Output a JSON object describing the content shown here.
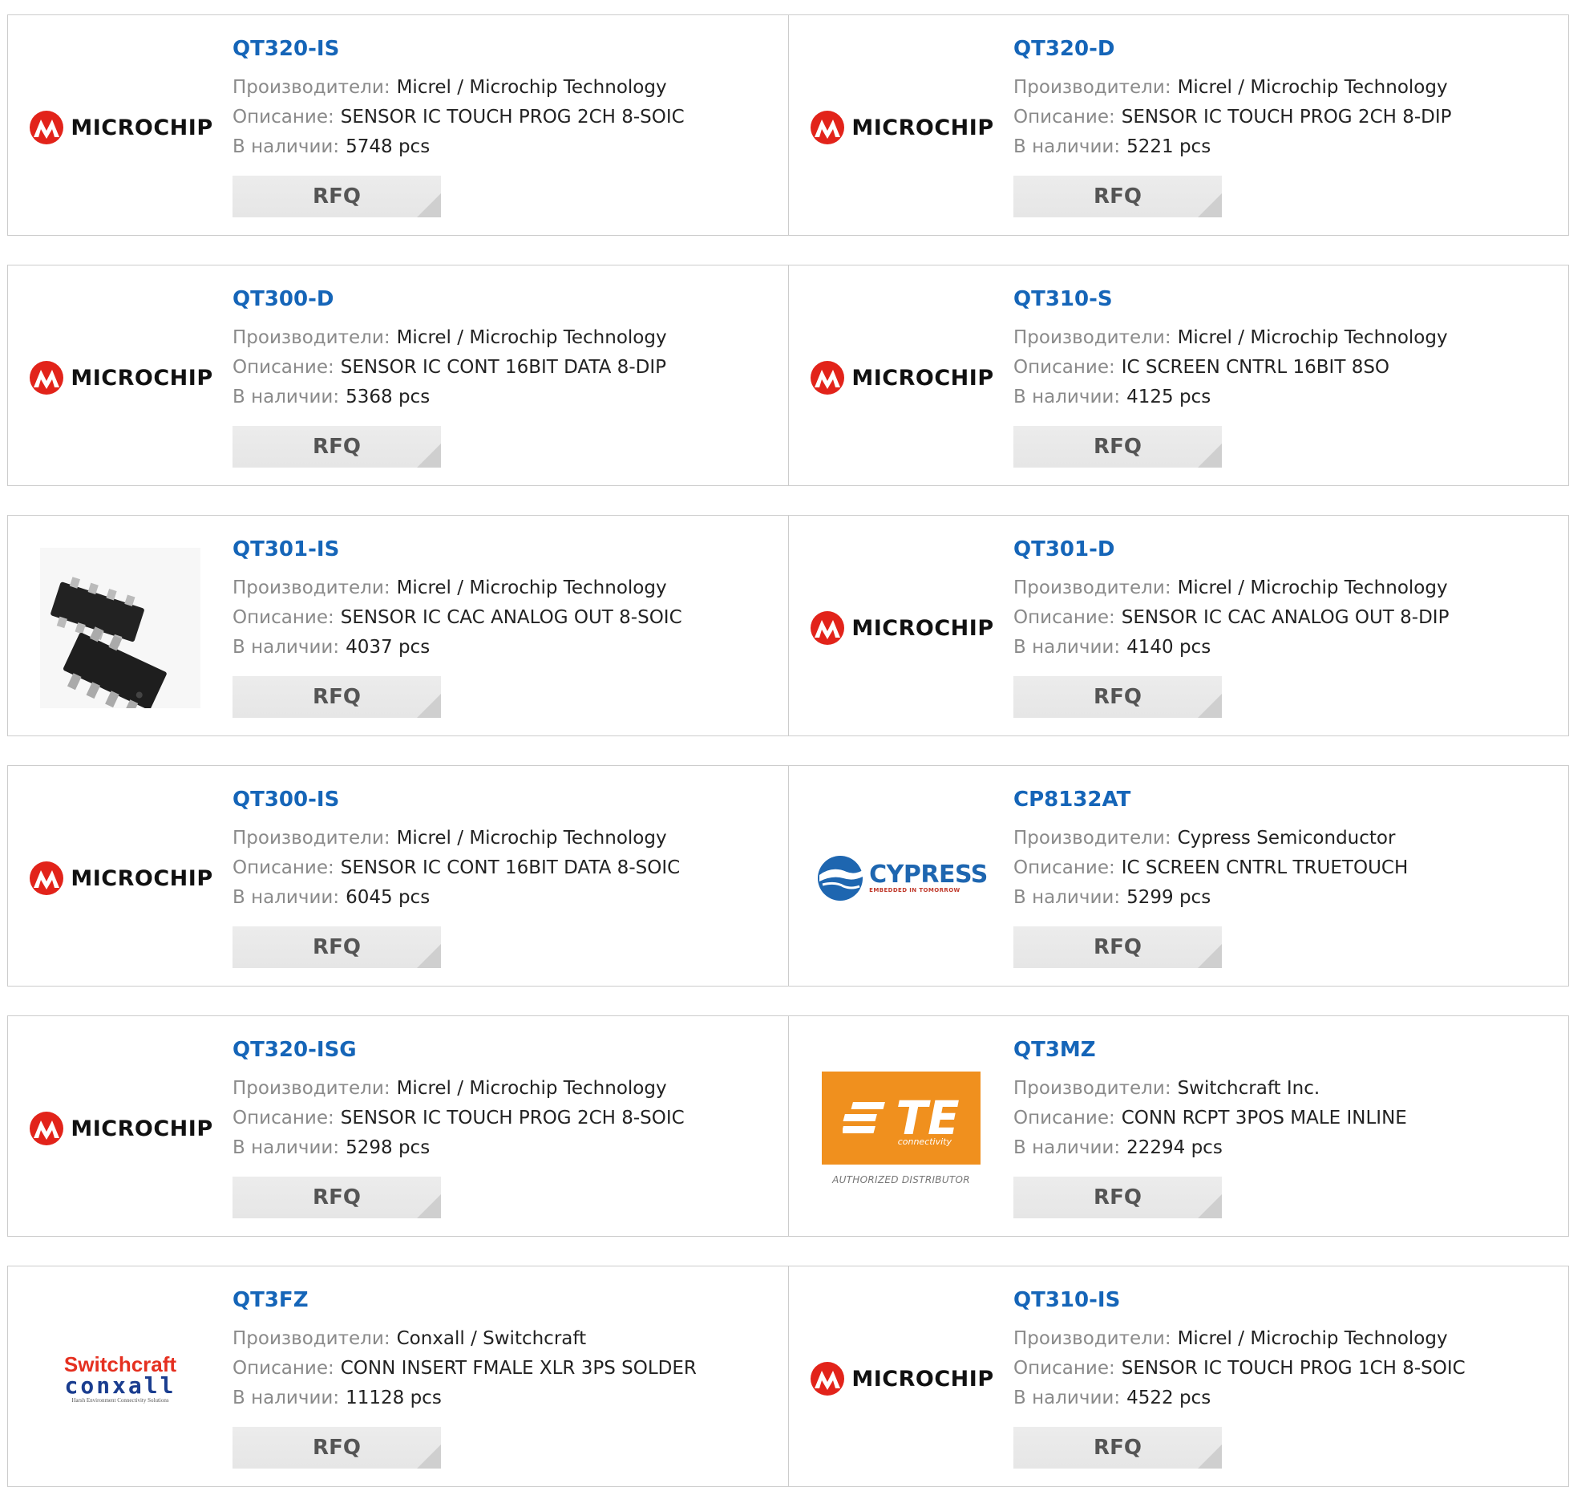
{
  "labels": {
    "manufacturer": "Производители:",
    "description": "Описание:",
    "stock": "В наличии:",
    "rfq": "RFQ"
  },
  "brand_logos": {
    "microchip": "MICROCHIP",
    "cypress": "CYPRESS",
    "cypress_tagline": "EMBEDDED IN TOMORROW",
    "te": "TE",
    "te_sub": "connectivity",
    "te_distributor": "AUTHORIZED DISTRIBUTOR",
    "switchcraft": "Switchcraft",
    "conxall": "conxall",
    "conxall_tagline": "Harsh Environment Connectivity Solutions"
  },
  "products": [
    {
      "part": "QT320-IS",
      "manufacturer": "Micrel / Microchip Technology",
      "description": "SENSOR IC TOUCH PROG 2CH 8-SOIC",
      "stock": "5748 pcs",
      "logo": "microchip"
    },
    {
      "part": "QT320-D",
      "manufacturer": "Micrel / Microchip Technology",
      "description": "SENSOR IC TOUCH PROG 2CH 8-DIP",
      "stock": "5221 pcs",
      "logo": "microchip"
    },
    {
      "part": "QT300-D",
      "manufacturer": "Micrel / Microchip Technology",
      "description": "SENSOR IC CONT 16BIT DATA 8-DIP",
      "stock": "5368 pcs",
      "logo": "microchip"
    },
    {
      "part": "QT310-S",
      "manufacturer": "Micrel / Microchip Technology",
      "description": "IC SCREEN CNTRL 16BIT 8SO",
      "stock": "4125 pcs",
      "logo": "microchip"
    },
    {
      "part": "QT301-IS",
      "manufacturer": "Micrel / Microchip Technology",
      "description": "SENSOR IC CAC ANALOG OUT 8-SOIC",
      "stock": "4037 pcs",
      "logo": "chip-photo"
    },
    {
      "part": "QT301-D",
      "manufacturer": "Micrel / Microchip Technology",
      "description": "SENSOR IC CAC ANALOG OUT 8-DIP",
      "stock": "4140 pcs",
      "logo": "microchip"
    },
    {
      "part": "QT300-IS",
      "manufacturer": "Micrel / Microchip Technology",
      "description": "SENSOR IC CONT 16BIT DATA 8-SOIC",
      "stock": "6045 pcs",
      "logo": "microchip"
    },
    {
      "part": "CP8132AT",
      "manufacturer": "Cypress Semiconductor",
      "description": "IC SCREEN CNTRL TRUETOUCH",
      "stock": "5299 pcs",
      "logo": "cypress"
    },
    {
      "part": "QT320-ISG",
      "manufacturer": "Micrel / Microchip Technology",
      "description": "SENSOR IC TOUCH PROG 2CH 8-SOIC",
      "stock": "5298 pcs",
      "logo": "microchip"
    },
    {
      "part": "QT3MZ",
      "manufacturer": "Switchcraft Inc.",
      "description": "CONN RCPT 3POS MALE INLINE",
      "stock": "22294 pcs",
      "logo": "te"
    },
    {
      "part": "QT3FZ",
      "manufacturer": "Conxall / Switchcraft",
      "description": "CONN INSERT FMALE XLR 3PS SOLDER",
      "stock": "11128 pcs",
      "logo": "switchcraft"
    },
    {
      "part": "QT310-IS",
      "manufacturer": "Micrel / Microchip Technology",
      "description": "SENSOR IC TOUCH PROG 1CH 8-SOIC",
      "stock": "4522 pcs",
      "logo": "microchip"
    }
  ],
  "colors": {
    "part_link": "#1565b8",
    "label": "#8a8a8a",
    "value": "#222222",
    "rfq_bg": "#e9e9e9",
    "border": "#cccccc",
    "microchip_red": "#e2231a",
    "te_orange": "#f0901e"
  }
}
